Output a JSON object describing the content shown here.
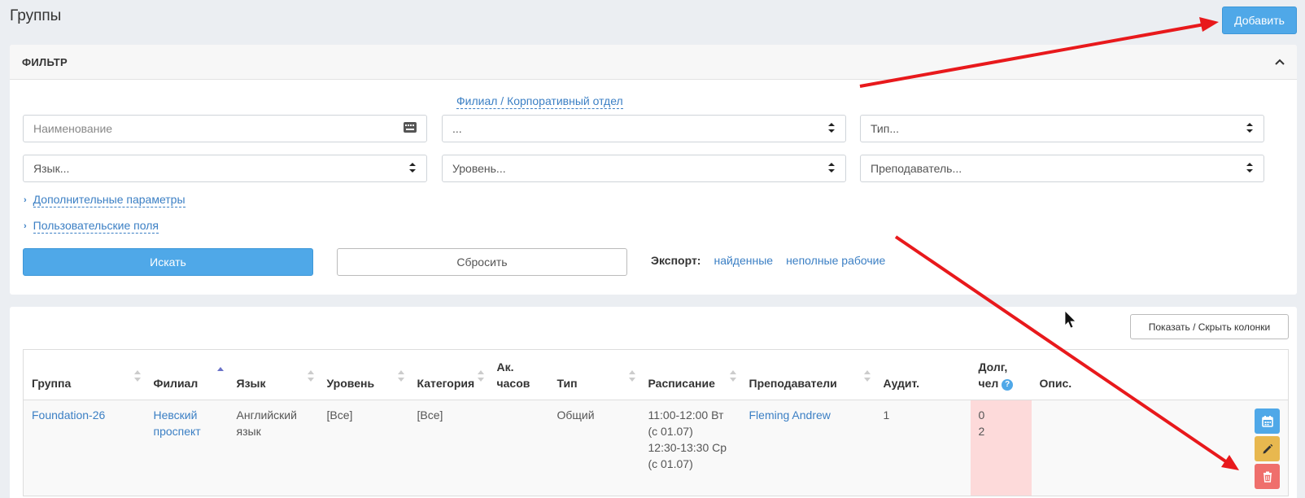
{
  "page": {
    "title": "Группы",
    "add_label": "Добавить"
  },
  "filter": {
    "title": "ФИЛЬТР",
    "branch_link": "Филиал / Корпоративный отдел",
    "name_placeholder": "Наименование",
    "branch_value": "...",
    "type_placeholder": "Тип...",
    "language_placeholder": "Язык...",
    "level_placeholder": "Уровень...",
    "teacher_placeholder": "Преподаватель...",
    "extra_params": "Дополнительные параметры",
    "custom_fields": "Пользовательские поля",
    "search_label": "Искать",
    "reset_label": "Сбросить",
    "export_label": "Экспорт:",
    "export_found": "найденные",
    "export_partial": "неполные рабочие"
  },
  "table": {
    "toggle_columns": "Показать / Скрыть колонки",
    "headers": {
      "group": "Группа",
      "branch": "Филиал",
      "language": "Язык",
      "level": "Уровень",
      "category": "Категория",
      "hours_1": "Ак.",
      "hours_2": "часов",
      "type": "Тип",
      "schedule": "Расписание",
      "teachers": "Преподаватели",
      "room": "Аудит.",
      "debt_1": "Долг,",
      "debt_2": "чел",
      "desc": "Опис."
    },
    "rows": [
      {
        "group": "Foundation-26",
        "branch_1": "Невский",
        "branch_2": "проспект",
        "language_1": "Английский",
        "language_2": "язык",
        "level": "[Все]",
        "category": "[Все]",
        "hours": "",
        "type": "Общий",
        "schedule_1": "11:00-12:00 Вт",
        "schedule_2": "(с 01.07)",
        "schedule_3": "12:30-13:30 Ср",
        "schedule_4": "(с 01.07)",
        "teacher": "Fleming Andrew",
        "room": "1",
        "debt_1": "0",
        "debt_2": "2",
        "desc": ""
      }
    ]
  },
  "colors": {
    "primary": "#4fa8e8",
    "warning": "#e8b84f",
    "danger": "#ef6f6c",
    "annotation_arrow": "#e8191c"
  }
}
